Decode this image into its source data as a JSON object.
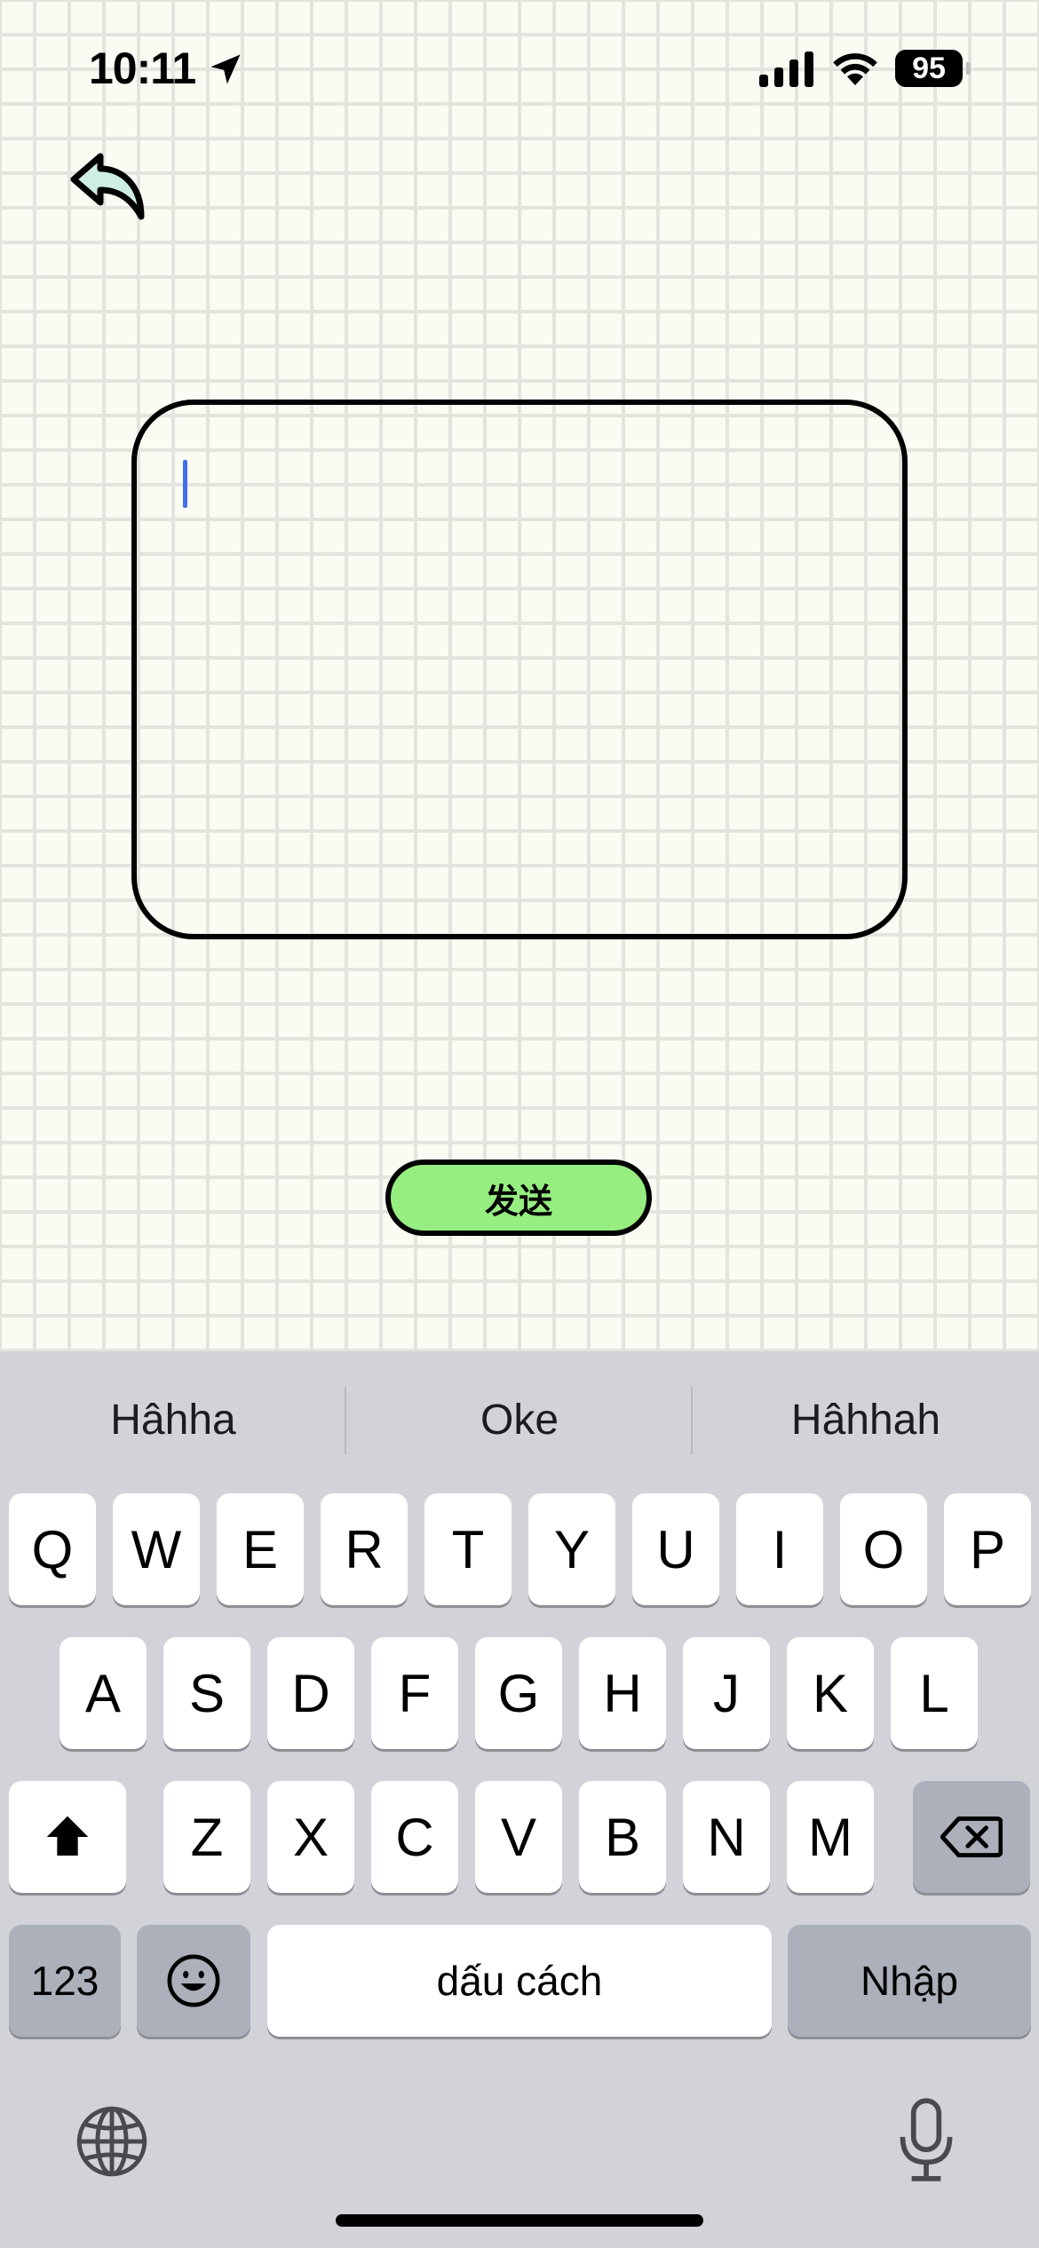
{
  "status": {
    "time": "10:11",
    "battery": "95",
    "icons": [
      "location-arrow-icon",
      "signal-icon",
      "wifi-icon",
      "battery-icon"
    ]
  },
  "back": {
    "icon": "back-arrow-icon"
  },
  "editor": {
    "value": ""
  },
  "send_button": {
    "label": "发送",
    "color": "#97ee80"
  },
  "keyboard": {
    "suggestions": [
      "Hâhha",
      "Oke",
      "Hâhhah"
    ],
    "row1": [
      "Q",
      "W",
      "E",
      "R",
      "T",
      "Y",
      "U",
      "I",
      "O",
      "P"
    ],
    "row2": [
      "A",
      "S",
      "D",
      "F",
      "G",
      "H",
      "J",
      "K",
      "L"
    ],
    "row3": [
      "Z",
      "X",
      "C",
      "V",
      "B",
      "N",
      "M"
    ],
    "numbers_label": "123",
    "space_label": "dấu cách",
    "return_label": "Nhập"
  }
}
